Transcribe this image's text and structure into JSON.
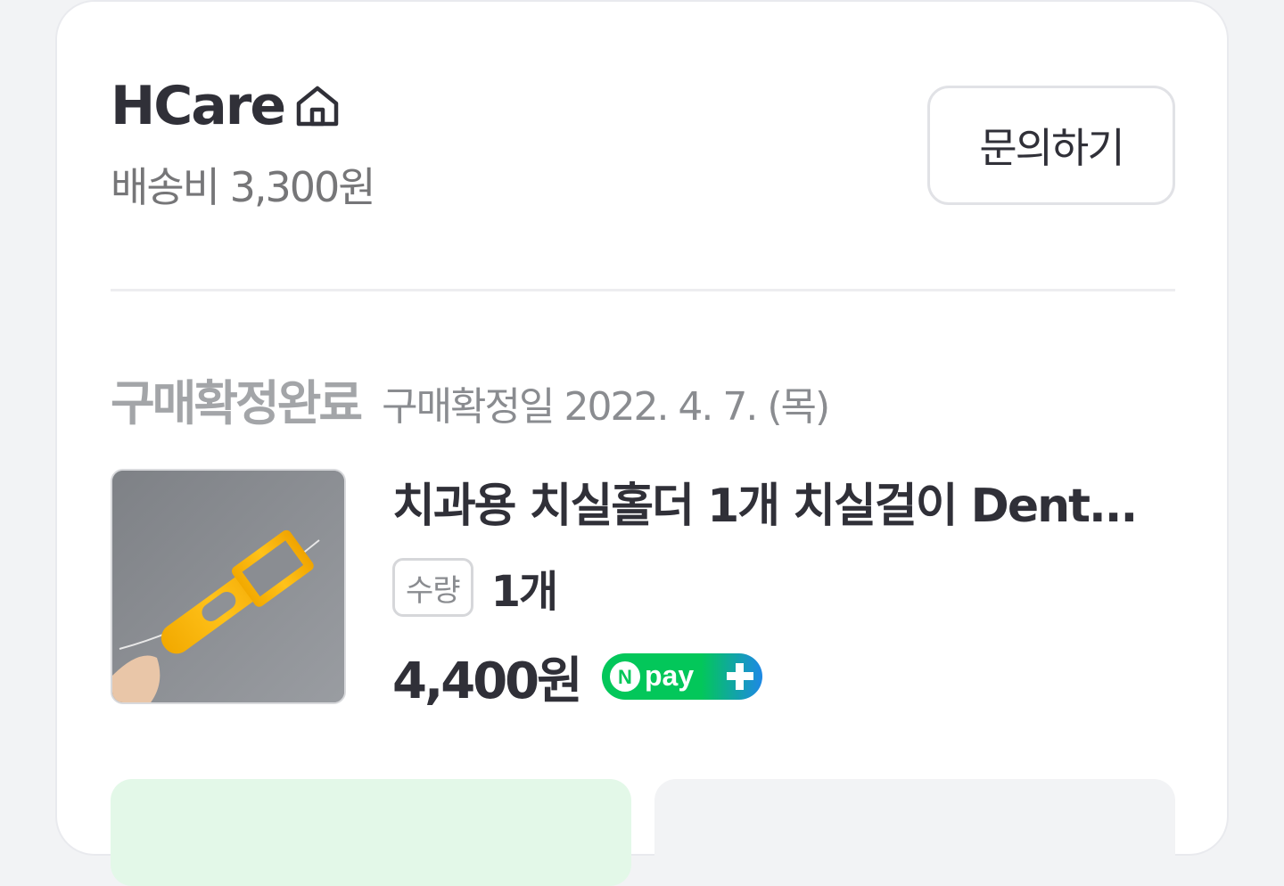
{
  "seller": {
    "name": "HCare",
    "shipping_fee": "배송비 3,300원",
    "inquiry_label": "문의하기"
  },
  "order": {
    "status": "구매확정완료",
    "confirm_date": "구매확정일 2022. 4. 7. (목)"
  },
  "product": {
    "title": "치과용 치실홀더 1개 치실걸이 Dent...",
    "quantity_label": "수량",
    "quantity_value": "1개",
    "price": "4,400원",
    "payment_badge": "npay+"
  },
  "colors": {
    "npay_green": "#03c75a",
    "npay_blue": "#1e88e5",
    "confirm_button_bg": "#e3f8e8",
    "secondary_button_bg": "#f2f3f5"
  }
}
